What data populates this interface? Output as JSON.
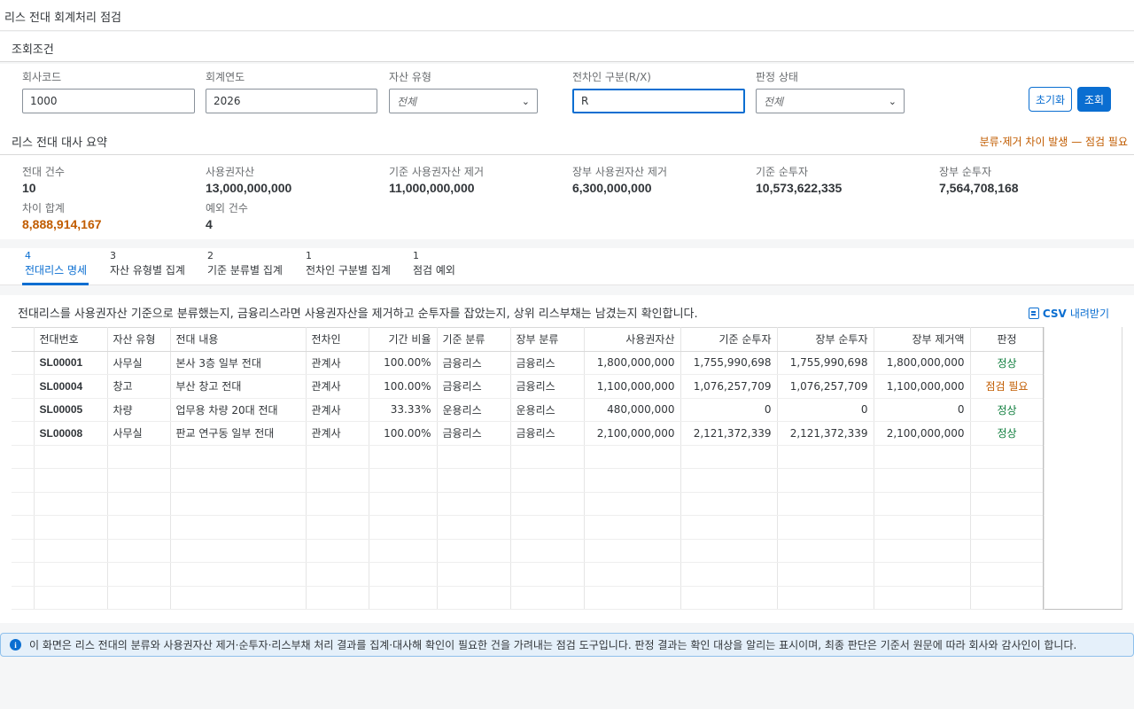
{
  "app": {
    "title": "리스 전대 회계처리 점검"
  },
  "filters": {
    "section_title": "조회조건",
    "company_code": {
      "label": "회사코드",
      "value": "1000"
    },
    "fiscal_year": {
      "label": "회계연도",
      "value": "2026"
    },
    "asset_type": {
      "label": "자산 유형",
      "value": "전체"
    },
    "lessee_type": {
      "label": "전차인 구분(R/X)",
      "value": "R"
    },
    "judgement_status": {
      "label": "판정 상태",
      "value": "전체"
    },
    "reset_label": "초기화",
    "search_label": "조회"
  },
  "summary": {
    "section_title": "리스 전대 대사 요약",
    "warning": "분류·제거 차이 발생 — 점검 필요",
    "kpis": [
      {
        "label": "전대 건수",
        "value": "10"
      },
      {
        "label": "사용권자산",
        "value": "13,000,000,000"
      },
      {
        "label": "기준 사용권자산 제거",
        "value": "11,000,000,000"
      },
      {
        "label": "장부 사용권자산 제거",
        "value": "6,300,000,000"
      },
      {
        "label": "기준 순투자",
        "value": "10,573,622,335"
      },
      {
        "label": "장부 순투자",
        "value": "7,564,708,168"
      },
      {
        "label": "차이 합계",
        "value": "8,888,914,167"
      },
      {
        "label": "예외 건수",
        "value": "4"
      }
    ]
  },
  "tabs": [
    {
      "count": "4",
      "label": "전대리스 명세"
    },
    {
      "count": "3",
      "label": "자산 유형별 집계"
    },
    {
      "count": "2",
      "label": "기준 분류별 집계"
    },
    {
      "count": "1",
      "label": "전차인 구분별 집계"
    },
    {
      "count": "1",
      "label": "점검 예외"
    }
  ],
  "table": {
    "description": "전대리스를 사용권자산 기준으로 분류했는지, 금융리스라면 사용권자산을 제거하고 순투자를 잡았는지, 상위 리스부채는 남겼는지 확인합니다.",
    "csv_label": "CSV",
    "csv_rest": "내려받기",
    "columns": [
      "전대번호",
      "자산 유형",
      "전대 내용",
      "전차인",
      "기간 비율",
      "기준 분류",
      "장부 분류",
      "사용권자산",
      "기준 순투자",
      "장부 순투자",
      "장부 제거액",
      "판정"
    ],
    "rows": [
      [
        "SL00001",
        "사무실",
        "본사 3층 일부 전대",
        "관계사",
        "100.00%",
        "금융리스",
        "금융리스",
        "1,800,000,000",
        "1,755,990,698",
        "1,755,990,698",
        "1,800,000,000",
        "정상"
      ],
      [
        "SL00004",
        "창고",
        "부산 창고 전대",
        "관계사",
        "100.00%",
        "금융리스",
        "금융리스",
        "1,100,000,000",
        "1,076,257,709",
        "1,076,257,709",
        "1,100,000,000",
        "점검 필요"
      ],
      [
        "SL00005",
        "차량",
        "업무용 차량 20대 전대",
        "관계사",
        "33.33%",
        "운용리스",
        "운용리스",
        "480,000,000",
        "0",
        "0",
        "0",
        "정상"
      ],
      [
        "SL00008",
        "사무실",
        "판교 연구동 일부 전대",
        "관계사",
        "100.00%",
        "금융리스",
        "금융리스",
        "2,100,000,000",
        "2,121,372,339",
        "2,121,372,339",
        "2,100,000,000",
        "정상"
      ]
    ],
    "empty_rows": 7
  },
  "info": {
    "icon": "info-icon",
    "message": "이 화면은 리스 전대의 분류와 사용권자산 제거·순투자·리스부채 처리 결과를 집계·대사해 확인이 필요한 건을 가려내는 점검 도구입니다. 판정 결과는 확인 대상을 알리는 표시이며, 최종 판단은 기준서 원문에 따라 회사와 감사인이 합니다."
  },
  "colors": {
    "accent": "#0a6ed1",
    "warning": "#c15c00",
    "positive": "#107e3e"
  }
}
